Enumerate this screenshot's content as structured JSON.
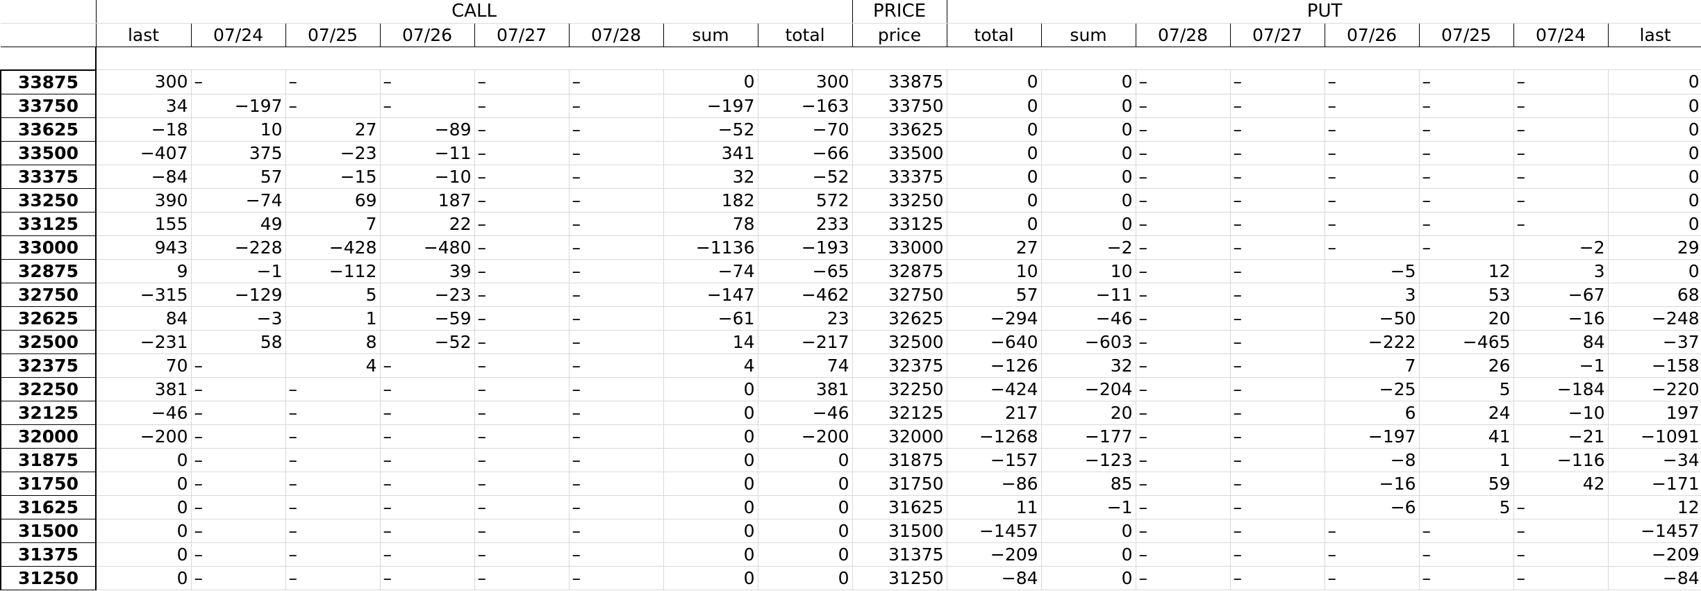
{
  "header": {
    "call_group": "CALL",
    "price_group": "PRICE",
    "put_group": "PUT",
    "columns": [
      "last",
      "07/24",
      "07/25",
      "07/26",
      "07/27",
      "07/28",
      "sum",
      "total",
      "price",
      "total",
      "sum",
      "07/28",
      "07/27",
      "07/26",
      "07/25",
      "07/24",
      "last"
    ]
  },
  "rows": [
    {
      "key": "33875",
      "cells": [
        "300",
        "–",
        "–",
        "–",
        "–",
        "–",
        "0",
        "300",
        "33875",
        "0",
        "0",
        "–",
        "–",
        "–",
        "–",
        "–",
        "0"
      ]
    },
    {
      "key": "33750",
      "cells": [
        "34",
        "-197",
        "–",
        "–",
        "–",
        "–",
        "-197",
        "-163",
        "33750",
        "0",
        "0",
        "–",
        "–",
        "–",
        "–",
        "–",
        "0"
      ]
    },
    {
      "key": "33625",
      "cells": [
        "-18",
        "10",
        "27",
        "-89",
        "–",
        "–",
        "-52",
        "-70",
        "33625",
        "0",
        "0",
        "–",
        "–",
        "–",
        "–",
        "–",
        "0"
      ]
    },
    {
      "key": "33500",
      "cells": [
        "-407",
        "375",
        "-23",
        "-11",
        "–",
        "–",
        "341",
        "-66",
        "33500",
        "0",
        "0",
        "–",
        "–",
        "–",
        "–",
        "–",
        "0"
      ]
    },
    {
      "key": "33375",
      "cells": [
        "-84",
        "57",
        "-15",
        "-10",
        "–",
        "–",
        "32",
        "-52",
        "33375",
        "0",
        "0",
        "–",
        "–",
        "–",
        "–",
        "–",
        "0"
      ]
    },
    {
      "key": "33250",
      "cells": [
        "390",
        "-74",
        "69",
        "187",
        "–",
        "–",
        "182",
        "572",
        "33250",
        "0",
        "0",
        "–",
        "–",
        "–",
        "–",
        "–",
        "0"
      ]
    },
    {
      "key": "33125",
      "cells": [
        "155",
        "49",
        "7",
        "22",
        "–",
        "–",
        "78",
        "233",
        "33125",
        "0",
        "0",
        "–",
        "–",
        "–",
        "–",
        "–",
        "0"
      ]
    },
    {
      "key": "33000",
      "cells": [
        "943",
        "-228",
        "-428",
        "-480",
        "–",
        "–",
        "-1136",
        "-193",
        "33000",
        "27",
        "-2",
        "–",
        "–",
        "–",
        "–",
        "-2",
        "29"
      ]
    },
    {
      "key": "32875",
      "cells": [
        "9",
        "-1",
        "-112",
        "39",
        "–",
        "–",
        "-74",
        "-65",
        "32875",
        "10",
        "10",
        "–",
        "–",
        "-5",
        "12",
        "3",
        "0"
      ]
    },
    {
      "key": "32750",
      "cells": [
        "-315",
        "-129",
        "5",
        "-23",
        "–",
        "–",
        "-147",
        "-462",
        "32750",
        "57",
        "-11",
        "–",
        "–",
        "3",
        "53",
        "-67",
        "68"
      ]
    },
    {
      "key": "32625",
      "cells": [
        "84",
        "-3",
        "1",
        "-59",
        "–",
        "–",
        "-61",
        "23",
        "32625",
        "-294",
        "-46",
        "–",
        "–",
        "-50",
        "20",
        "-16",
        "-248"
      ]
    },
    {
      "key": "32500",
      "cells": [
        "-231",
        "58",
        "8",
        "-52",
        "–",
        "–",
        "14",
        "-217",
        "32500",
        "-640",
        "-603",
        "–",
        "–",
        "-222",
        "-465",
        "84",
        "-37"
      ]
    },
    {
      "key": "32375",
      "cells": [
        "70",
        "–",
        "4",
        "–",
        "–",
        "–",
        "4",
        "74",
        "32375",
        "-126",
        "32",
        "–",
        "–",
        "7",
        "26",
        "-1",
        "-158"
      ]
    },
    {
      "key": "32250",
      "cells": [
        "381",
        "–",
        "–",
        "–",
        "–",
        "–",
        "0",
        "381",
        "32250",
        "-424",
        "-204",
        "–",
        "–",
        "-25",
        "5",
        "-184",
        "-220"
      ]
    },
    {
      "key": "32125",
      "cells": [
        "-46",
        "–",
        "–",
        "–",
        "–",
        "–",
        "0",
        "-46",
        "32125",
        "217",
        "20",
        "–",
        "–",
        "6",
        "24",
        "-10",
        "197"
      ]
    },
    {
      "key": "32000",
      "cells": [
        "-200",
        "–",
        "–",
        "–",
        "–",
        "–",
        "0",
        "-200",
        "32000",
        "-1268",
        "-177",
        "–",
        "–",
        "-197",
        "41",
        "-21",
        "-1091"
      ]
    },
    {
      "key": "31875",
      "cells": [
        "0",
        "–",
        "–",
        "–",
        "–",
        "–",
        "0",
        "0",
        "31875",
        "-157",
        "-123",
        "–",
        "–",
        "-8",
        "1",
        "-116",
        "-34"
      ]
    },
    {
      "key": "31750",
      "cells": [
        "0",
        "–",
        "–",
        "–",
        "–",
        "–",
        "0",
        "0",
        "31750",
        "-86",
        "85",
        "–",
        "–",
        "-16",
        "59",
        "42",
        "-171"
      ]
    },
    {
      "key": "31625",
      "cells": [
        "0",
        "–",
        "–",
        "–",
        "–",
        "–",
        "0",
        "0",
        "31625",
        "11",
        "-1",
        "–",
        "–",
        "-6",
        "5",
        "–",
        "12"
      ]
    },
    {
      "key": "31500",
      "cells": [
        "0",
        "–",
        "–",
        "–",
        "–",
        "–",
        "0",
        "0",
        "31500",
        "-1457",
        "0",
        "–",
        "–",
        "–",
        "–",
        "–",
        "-1457"
      ]
    },
    {
      "key": "31375",
      "cells": [
        "0",
        "–",
        "–",
        "–",
        "–",
        "–",
        "0",
        "0",
        "31375",
        "-209",
        "0",
        "–",
        "–",
        "–",
        "–",
        "–",
        "-209"
      ]
    },
    {
      "key": "31250",
      "cells": [
        "0",
        "–",
        "–",
        "–",
        "–",
        "–",
        "0",
        "0",
        "31250",
        "-84",
        "0",
        "–",
        "–",
        "–",
        "–",
        "–",
        "-84"
      ]
    }
  ]
}
